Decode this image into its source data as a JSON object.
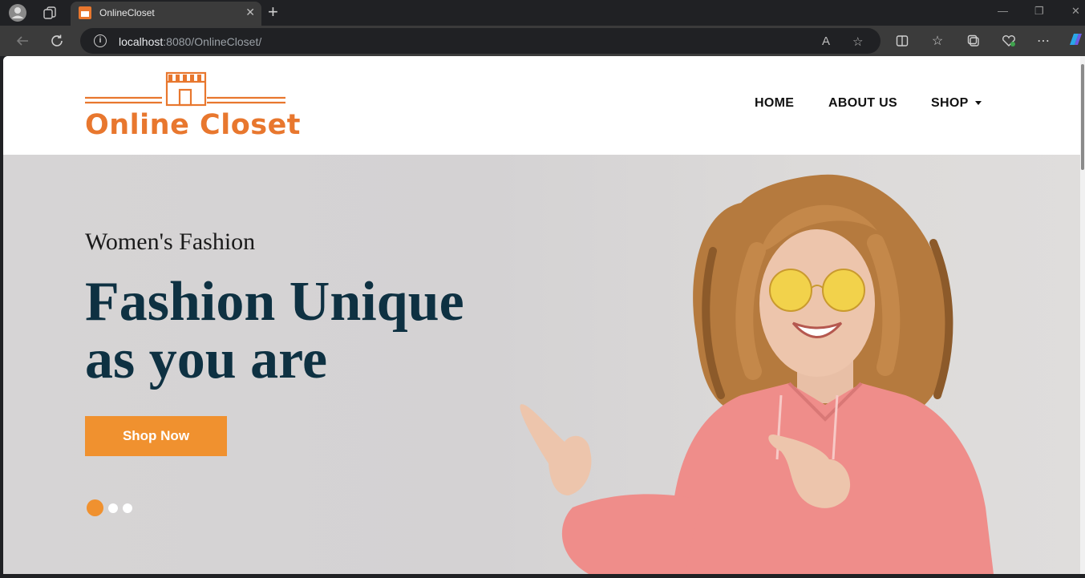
{
  "browser": {
    "tab_title": "OnlineCloset",
    "url_host": "localhost",
    "url_rest": ":8080/OnlineCloset/"
  },
  "site": {
    "brand": "Online Closet",
    "nav": {
      "home": "HOME",
      "about": "ABOUT US",
      "shop": "SHOP"
    }
  },
  "hero": {
    "eyebrow": "Women's Fashion",
    "headline_line1": "Fashion Unique",
    "headline_line2": "as you are",
    "cta": "Shop Now",
    "slides_total": 3,
    "slide_active": 1
  },
  "colors": {
    "accent": "#f0912f",
    "brand": "#e8772e",
    "headline": "#0e3142"
  }
}
